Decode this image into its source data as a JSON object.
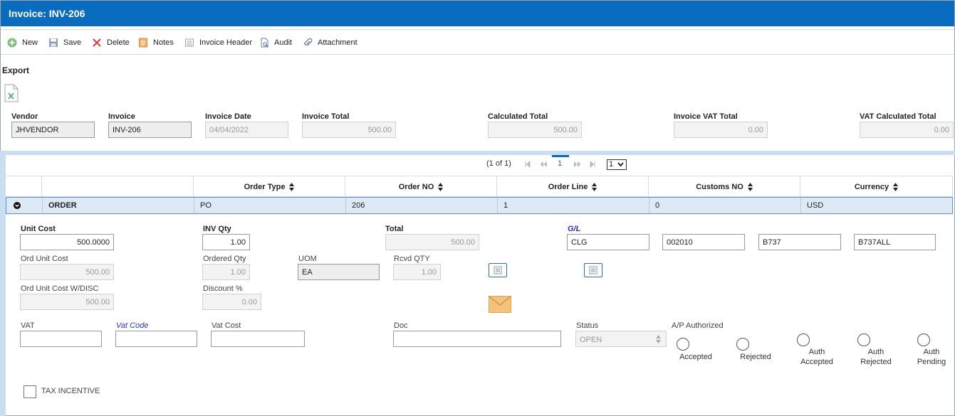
{
  "window": {
    "title": "Invoice: INV-206"
  },
  "toolbar": {
    "new": "New",
    "save": "Save",
    "delete": "Delete",
    "notes": "Notes",
    "invoice_header": "Invoice Header",
    "audit": "Audit",
    "attachment": "Attachment"
  },
  "export": {
    "label": "Export",
    "icon": "excel-export-icon"
  },
  "header_fields": {
    "vendor": {
      "label": "Vendor",
      "value": "JHVENDOR"
    },
    "invoice": {
      "label": "Invoice",
      "value": "INV-206"
    },
    "invoice_date": {
      "label": "Invoice Date",
      "value": "04/04/2022"
    },
    "invoice_total": {
      "label": "Invoice Total",
      "value": "500.00"
    },
    "calculated_total": {
      "label": "Calculated Total",
      "value": "500.00"
    },
    "invoice_vat_total": {
      "label": "Invoice VAT Total",
      "value": "0.00"
    },
    "vat_calculated_total": {
      "label": "VAT Calculated Total",
      "value": "0.00"
    }
  },
  "pager": {
    "summary": "(1 of 1)",
    "current_page": "1",
    "page_select": "1"
  },
  "grid": {
    "columns": [
      "Order Type",
      "Order NO",
      "Order Line",
      "Customs NO",
      "Currency"
    ],
    "row": {
      "group": "ORDER",
      "order_type": "PO",
      "order_no": "206",
      "order_line": "1",
      "customs_no": "0",
      "currency": "USD"
    }
  },
  "detail": {
    "unit_cost": {
      "label": "Unit Cost",
      "value": "500.0000"
    },
    "inv_qty": {
      "label": "INV Qty",
      "value": "1.00"
    },
    "total": {
      "label": "Total",
      "value": "500.00"
    },
    "gl": {
      "label": "G/L",
      "values": [
        "CLG",
        "002010",
        "B737",
        "B737ALL"
      ]
    },
    "ord_unit_cost": {
      "label": "Ord Unit Cost",
      "value": "500.00"
    },
    "ordered_qty": {
      "label": "Ordered Qty",
      "value": "1.00"
    },
    "uom": {
      "label": "UOM",
      "value": "EA"
    },
    "rcvd_qty": {
      "label": "Rcvd QTY",
      "value": "1.00"
    },
    "ord_unit_cost_disc": {
      "label": "Ord Unit Cost W/DISC",
      "value": "500.00"
    },
    "discount": {
      "label": "Discount %",
      "value": "0.00"
    },
    "vat": {
      "label": "VAT",
      "value": ""
    },
    "vat_code": {
      "label": "Vat Code",
      "value": ""
    },
    "vat_cost": {
      "label": "Vat Cost",
      "value": ""
    },
    "doc": {
      "label": "Doc",
      "value": ""
    },
    "status": {
      "label": "Status",
      "value": "OPEN"
    },
    "ap_authorized": {
      "label": "A/P Authorized",
      "options": [
        "Accepted",
        "Rejected",
        "Auth\nAccepted",
        "Auth\nRejected",
        "Auth\nPending"
      ]
    },
    "tax_incentive": {
      "label": "TAX INCENTIVE"
    }
  },
  "colors": {
    "title_bar": "#0a6cbf",
    "row_highlight": "#dde9f5",
    "link": "#2233cc"
  }
}
